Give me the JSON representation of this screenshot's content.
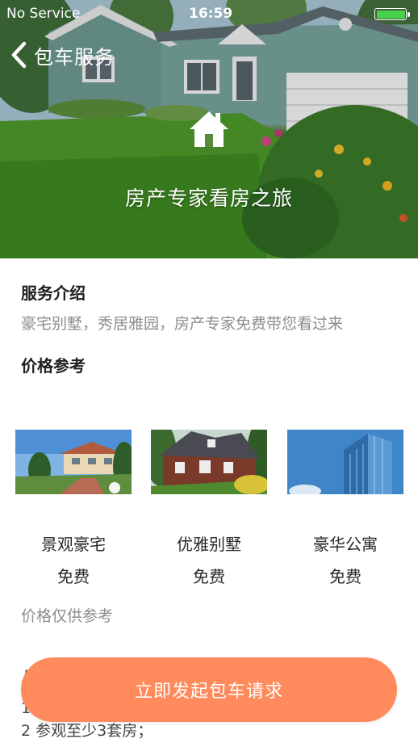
{
  "status_bar": {
    "carrier": "No Service",
    "time": "16:59",
    "battery_color": "#49d04d"
  },
  "nav": {
    "back_icon": "chevron-left-icon",
    "title": "包车服务"
  },
  "hero": {
    "icon": "house-icon",
    "title": "房产专家看房之旅"
  },
  "service_intro": {
    "heading": "服务介绍",
    "text": "豪宅别墅，秀居雅园，房产专家免费带您看过来"
  },
  "price_reference": {
    "heading": "价格参考",
    "items": [
      {
        "name": "景观豪宅",
        "price": "免费"
      },
      {
        "name": "优雅别墅",
        "price": "免费"
      },
      {
        "name": "豪华公寓",
        "price": "免费"
      }
    ],
    "note": "价格仅供参考"
  },
  "underlying_text": {
    "partial_heading": "八",
    "line1": "1",
    "line2": "2 参观至少3套房；"
  },
  "cta": {
    "label": "立即发起包车请求",
    "color": "#ff8a5b"
  }
}
